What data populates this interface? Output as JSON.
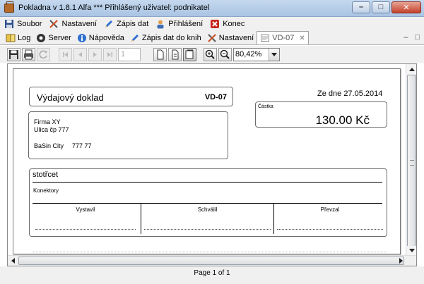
{
  "window": {
    "title": "Pokladna v 1.8.1 Alfa ***  Přihlášený uživatel: podnikatel",
    "minimize_glyph": "–",
    "maximize_glyph": "□",
    "close_glyph": "✕"
  },
  "menu": {
    "items": [
      {
        "label": "Soubor",
        "icon": "floppy-icon"
      },
      {
        "label": "Nastavení",
        "icon": "tools-icon"
      },
      {
        "label": "Zápis dat",
        "icon": "pencil-icon"
      },
      {
        "label": "Přihlášení",
        "icon": "user-icon"
      },
      {
        "label": "Konec",
        "icon": "exit-icon"
      }
    ]
  },
  "tabs": {
    "items": [
      {
        "label": "Log",
        "icon": "book-icon"
      },
      {
        "label": "Server",
        "icon": "server-icon"
      },
      {
        "label": "Nápověda",
        "icon": "info-icon"
      },
      {
        "label": "Zápis dat do knih",
        "icon": "pencil-icon"
      },
      {
        "label": "Nastavení",
        "icon": "tools-icon"
      },
      {
        "label": "VD-07",
        "icon": "document-icon",
        "active": true,
        "close_glyph": "✕"
      }
    ],
    "minimize_glyph": "–",
    "maximize_glyph": "□"
  },
  "toolbar": {
    "page_value": "1",
    "zoom_value": "80,42%"
  },
  "document": {
    "title": "Výdajový doklad",
    "number": "VD-07",
    "date_label": "Ze dne",
    "date_value": "27.05.2014",
    "amount_label": "Částka",
    "amount_value": "130.00 Kč",
    "firm": {
      "name": "Firma XY",
      "street": "Ulica čp 777",
      "city": "BaSin City",
      "zip": "777 77"
    },
    "description_title": "stotřcet",
    "description_item": "Konektory",
    "signatures": [
      "Vystavil",
      "Schválil",
      "Převzal"
    ]
  },
  "status": {
    "text": "Page 1 of 1"
  },
  "colors": {
    "titlebar": "#b9cfe9",
    "chrome": "#f0f0f0",
    "close_button": "#c4422b"
  }
}
